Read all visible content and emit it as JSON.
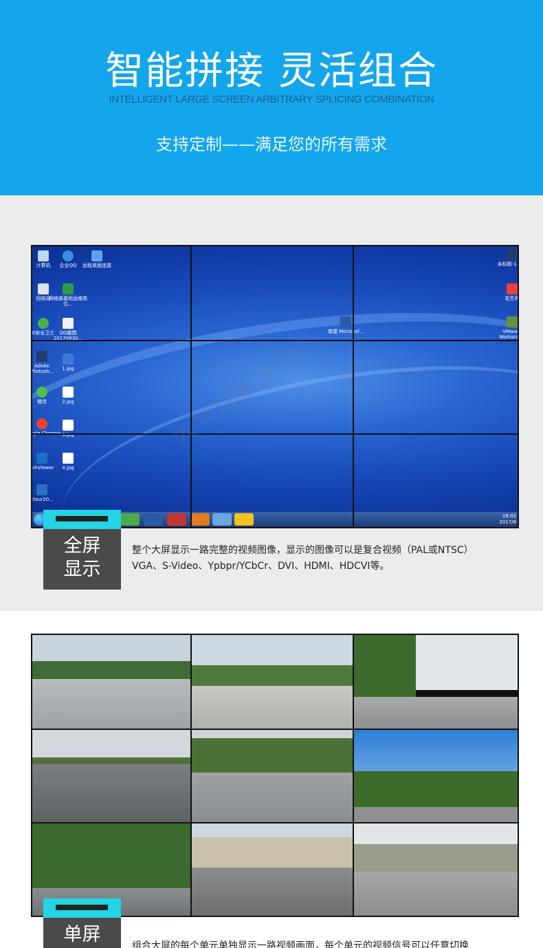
{
  "hero": {
    "title": "智能拼接 灵活组合",
    "subtitle": "INTELLIGENT LARGE SCREEN ARBITRARY SPLICING COMBINATION",
    "tagline": "支持定制——满足您的所有需求"
  },
  "section_fullscreen": {
    "badge_line1": "全屏",
    "badge_line2": "显示",
    "desc_line1": "整个大屏显示一路完整的视频图像，显示的图像可以是复合视频（PAL或NTSC）",
    "desc_line2": "VGA、S-Video、Ypbpr/YCbCr、DVI、HDMI、HDCVI等。",
    "desktop_icons": [
      {
        "label": "计算机",
        "color": "#bcd8f5"
      },
      {
        "label": "企业QQ",
        "color": "#3a8fe0"
      },
      {
        "label": "远程桌面连接",
        "color": "#5ea0e8"
      },
      {
        "label": "回收站",
        "color": "#d8e6f2"
      },
      {
        "label": "网络部基础运维岗位...",
        "color": "#2f9c4a"
      },
      {
        "label": "0安全卫士",
        "color": "#4bb04a"
      },
      {
        "label": "QQ截图20170830...",
        "color": "#f2f2f2"
      },
      {
        "label": "Adobe Photosh...",
        "color": "#1f3e6e"
      },
      {
        "label": "1.jpg",
        "color": "#3a7bd5"
      },
      {
        "label": "微信",
        "color": "#4fc24a"
      },
      {
        "label": "2.jpg",
        "color": "#ffffff"
      },
      {
        "label": "Google Chrome",
        "color": "#e94235"
      },
      {
        "label": "3.jpg",
        "color": "#ffffff"
      },
      {
        "label": "amViewer",
        "color": "#1c6fc9"
      },
      {
        "label": "4.jpg",
        "color": "#ffffff"
      },
      {
        "label": "ctour20...",
        "color": "#2d6fc0"
      },
      {
        "label": "新建 Microsof...",
        "color": "#2b5aa8"
      },
      {
        "label": "未标题-1.psd",
        "color": "#1f3e6e"
      },
      {
        "label": "花生壳",
        "color": "#e8423a"
      },
      {
        "label": "VMware Workstat...",
        "color": "#6b8e3a"
      }
    ],
    "clock_time": "18:02",
    "clock_date": "2017/8"
  },
  "section_single": {
    "badge_line1": "单屏",
    "desc_line1": "组合大屏的每个单元单独显示一路视频画面，每个单元的视频信号可以任意切换"
  },
  "watermark": "大华TB批发中心",
  "colors": {
    "hero_bg": "#14a6ec",
    "badge_cyan": "#22d4e4",
    "badge_gray": "#4a4a4a"
  }
}
